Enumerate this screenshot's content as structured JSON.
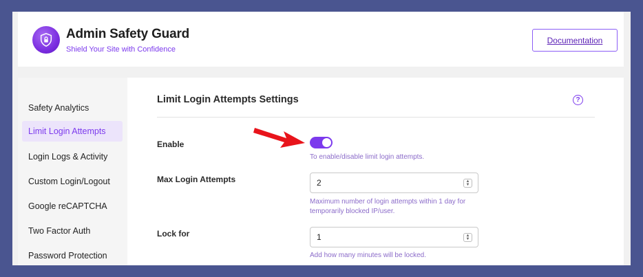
{
  "header": {
    "app_title": "Admin Safety Guard",
    "subtitle": "Shield Your Site with Confidence",
    "documentation_label": "Documentation"
  },
  "sidebar": {
    "items": [
      {
        "label": "Safety Analytics",
        "active": false
      },
      {
        "label": "Limit Login Attempts",
        "active": true
      },
      {
        "label": "Login Logs & Activity",
        "active": false
      },
      {
        "label": "Custom Login/Logout",
        "active": false
      },
      {
        "label": "Google reCAPTCHA",
        "active": false
      },
      {
        "label": "Two Factor Auth",
        "active": false
      },
      {
        "label": "Password Protection",
        "active": false
      }
    ]
  },
  "main": {
    "title": "Limit Login Attempts Settings",
    "help_glyph": "?",
    "enable": {
      "label": "Enable",
      "on": true,
      "hint": "To enable/disable limit login attempts."
    },
    "max_attempts": {
      "label": "Max Login Attempts",
      "value": "2",
      "hint_line1": "Maximum number of login attempts within 1 day for",
      "hint_line2": "temporarily blocked IP/user."
    },
    "lock_for": {
      "label": "Lock for",
      "value": "1",
      "hint": "Add how many minutes will be locked."
    }
  },
  "colors": {
    "accent": "#7c3aed",
    "background": "#4a5590",
    "annotation_arrow": "#e8141b"
  },
  "icons": {
    "logo": "shield-lock-icon",
    "help": "question-circle-icon",
    "spinner": "chevron-up-down-icon",
    "annotation": "red-arrow-icon"
  }
}
